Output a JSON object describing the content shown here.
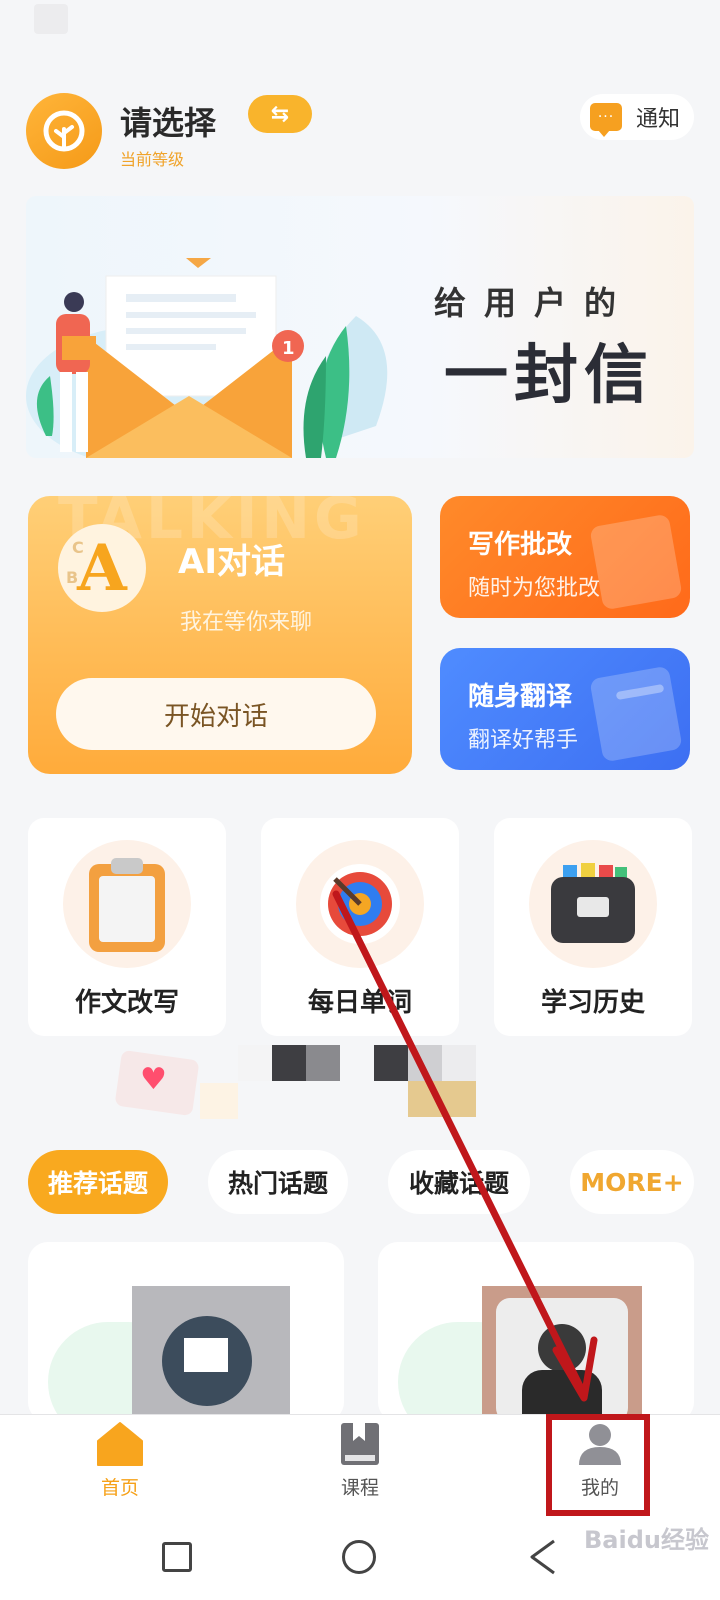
{
  "header": {
    "title": "请选择",
    "subtitle": "当前等级",
    "switch_icon": "swap-arrows-icon",
    "notify_label": "通知"
  },
  "banner": {
    "line1": "给用户的",
    "line2": "一封信",
    "badge": "1"
  },
  "ai_card": {
    "watermark": "TALKING",
    "title": "AI对话",
    "subtitle": "我在等你来聊",
    "button": "开始对话"
  },
  "write_card": {
    "title": "写作批改",
    "subtitle": "随时为您批改"
  },
  "translate_card": {
    "title": "随身翻译",
    "subtitle": "翻译好帮手"
  },
  "features": [
    {
      "label": "作文改写",
      "icon": "clipboard-icon"
    },
    {
      "label": "每日单词",
      "icon": "target-icon"
    },
    {
      "label": "学习历史",
      "icon": "file-box-icon"
    }
  ],
  "topics": [
    {
      "label": "推荐话题",
      "active": true
    },
    {
      "label": "热门话题",
      "active": false
    },
    {
      "label": "收藏话题",
      "active": false
    },
    {
      "label": "MORE+",
      "active": false
    }
  ],
  "nav": [
    {
      "label": "首页",
      "icon": "home-icon",
      "active": true
    },
    {
      "label": "课程",
      "icon": "book-icon",
      "active": false
    },
    {
      "label": "我的",
      "icon": "user-icon",
      "active": false
    }
  ],
  "watermark_text": "Baidu经验",
  "colors": {
    "accent": "#f9a91f",
    "orange_card": "#ff7a22",
    "blue_card": "#4580f8",
    "annotation": "#c0171b"
  }
}
